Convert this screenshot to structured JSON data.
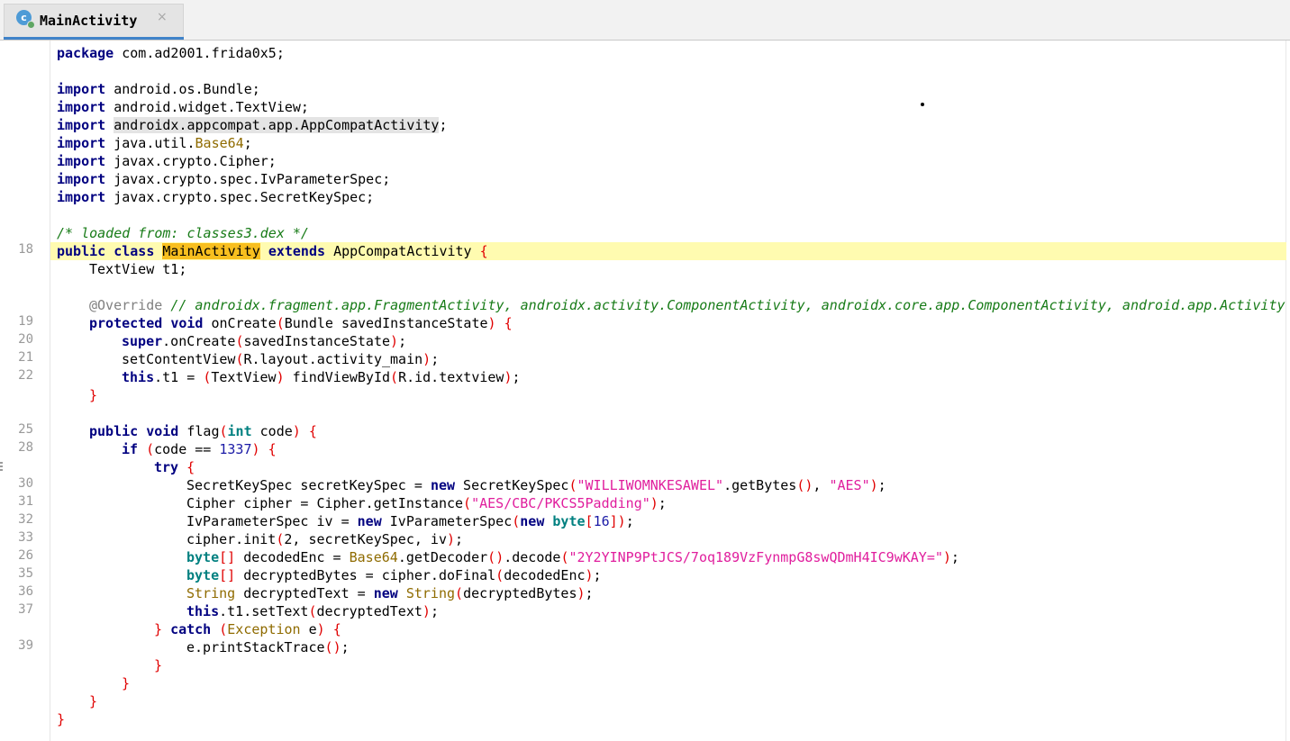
{
  "tab": {
    "title": "MainActivity",
    "close": "×",
    "icon_letter": "c"
  },
  "gutter": {
    "line_numbers": [
      "18",
      "19",
      "20",
      "21",
      "22",
      "25",
      "28",
      "30",
      "31",
      "32",
      "33",
      "26",
      "35",
      "36",
      "37",
      "39"
    ]
  },
  "code": {
    "package_kw": "package",
    "package_name": "com.ad2001.frida0x5;",
    "import_kw": "import",
    "imp1": "android.os.Bundle;",
    "imp2": "android.widget.TextView;",
    "imp3": "androidx.appcompat.app.AppCompatActivity",
    "semi": ";",
    "imp4_pre": "java.util.",
    "imp4_cls": "Base64",
    "imp5": "javax.crypto.Cipher;",
    "imp6": "javax.crypto.spec.IvParameterSpec;",
    "imp7": "javax.crypto.spec.SecretKeySpec;",
    "loaded_comment": "/* loaded from: classes3.dex */",
    "kw_public": "public",
    "kw_class": "class",
    "class_name": "MainActivity",
    "kw_extends": "extends",
    "super_class": "AppCompatActivity",
    "open_brace": "{",
    "close_brace": "}",
    "field": "TextView t1;",
    "override": "@Override",
    "override_comment": "// androidx.fragment.app.FragmentActivity, androidx.activity.ComponentActivity, androidx.core.app.ComponentActivity, android.app.Activity",
    "kw_protected": "protected",
    "kw_void": "void",
    "m_oncreate": "onCreate",
    "oncreate_args": "Bundle savedInstanceState",
    "paren_open": "(",
    "paren_close": ")",
    "kw_super": "super",
    "super_call": ".onCreate",
    "super_args": "savedInstanceState",
    "set_content": "setContentView",
    "layout_ref": "R.layout.activity_main",
    "kw_this": "this",
    "t1_assign": ".t1 = ",
    "cast_type": "TextView",
    "find_view": " findViewById",
    "view_id": "R.id.textview",
    "m_flag": "flag",
    "kw_int": "int",
    "flag_param": " code",
    "kw_if": "if",
    "code_eq": "code == ",
    "num_1337": "1337",
    "kw_try": "try",
    "sks_decl": "SecretKeySpec secretKeySpec = ",
    "kw_new": "new",
    "sks_type": " SecretKeySpec",
    "key_str": "\"WILLIWOMNKESAWEL\"",
    "get_bytes": ".getBytes",
    "comma": ", ",
    "aes_str": "\"AES\"",
    "cipher_decl": "Cipher cipher = Cipher.getInstance",
    "transform_str": "\"AES/CBC/PKCS5Padding\"",
    "iv_decl": "IvParameterSpec iv = ",
    "iv_type": " IvParameterSpec",
    "kw_byte": "byte",
    "num_16": "16",
    "bracket_open": "[",
    "bracket_close": "]",
    "brackets": "[]",
    "cipher_init": "cipher.init",
    "num_2": "2",
    "init_args": ", secretKeySpec, iv",
    "dec_decl": " decodedEnc = ",
    "base64_cls": "Base64",
    "get_decoder": ".getDecoder",
    "decode_call": ".decode",
    "cipher_str": "\"2Y2YINP9PtJCS/7oq189VzFynmpG8swQDmH4IC9wKAY=\"",
    "decb_decl": " decryptedBytes = cipher.doFinal",
    "decb_arg": "decodedEnc",
    "string_cls": "String",
    "dect_decl": " decryptedText = ",
    "dect_arg": "decryptedBytes",
    "set_text": ".t1.setText",
    "set_text_arg": "decryptedText",
    "kw_catch": "catch",
    "exception_cls": "Exception",
    "catch_var": " e",
    "print_trace": "e.printStackTrace"
  }
}
